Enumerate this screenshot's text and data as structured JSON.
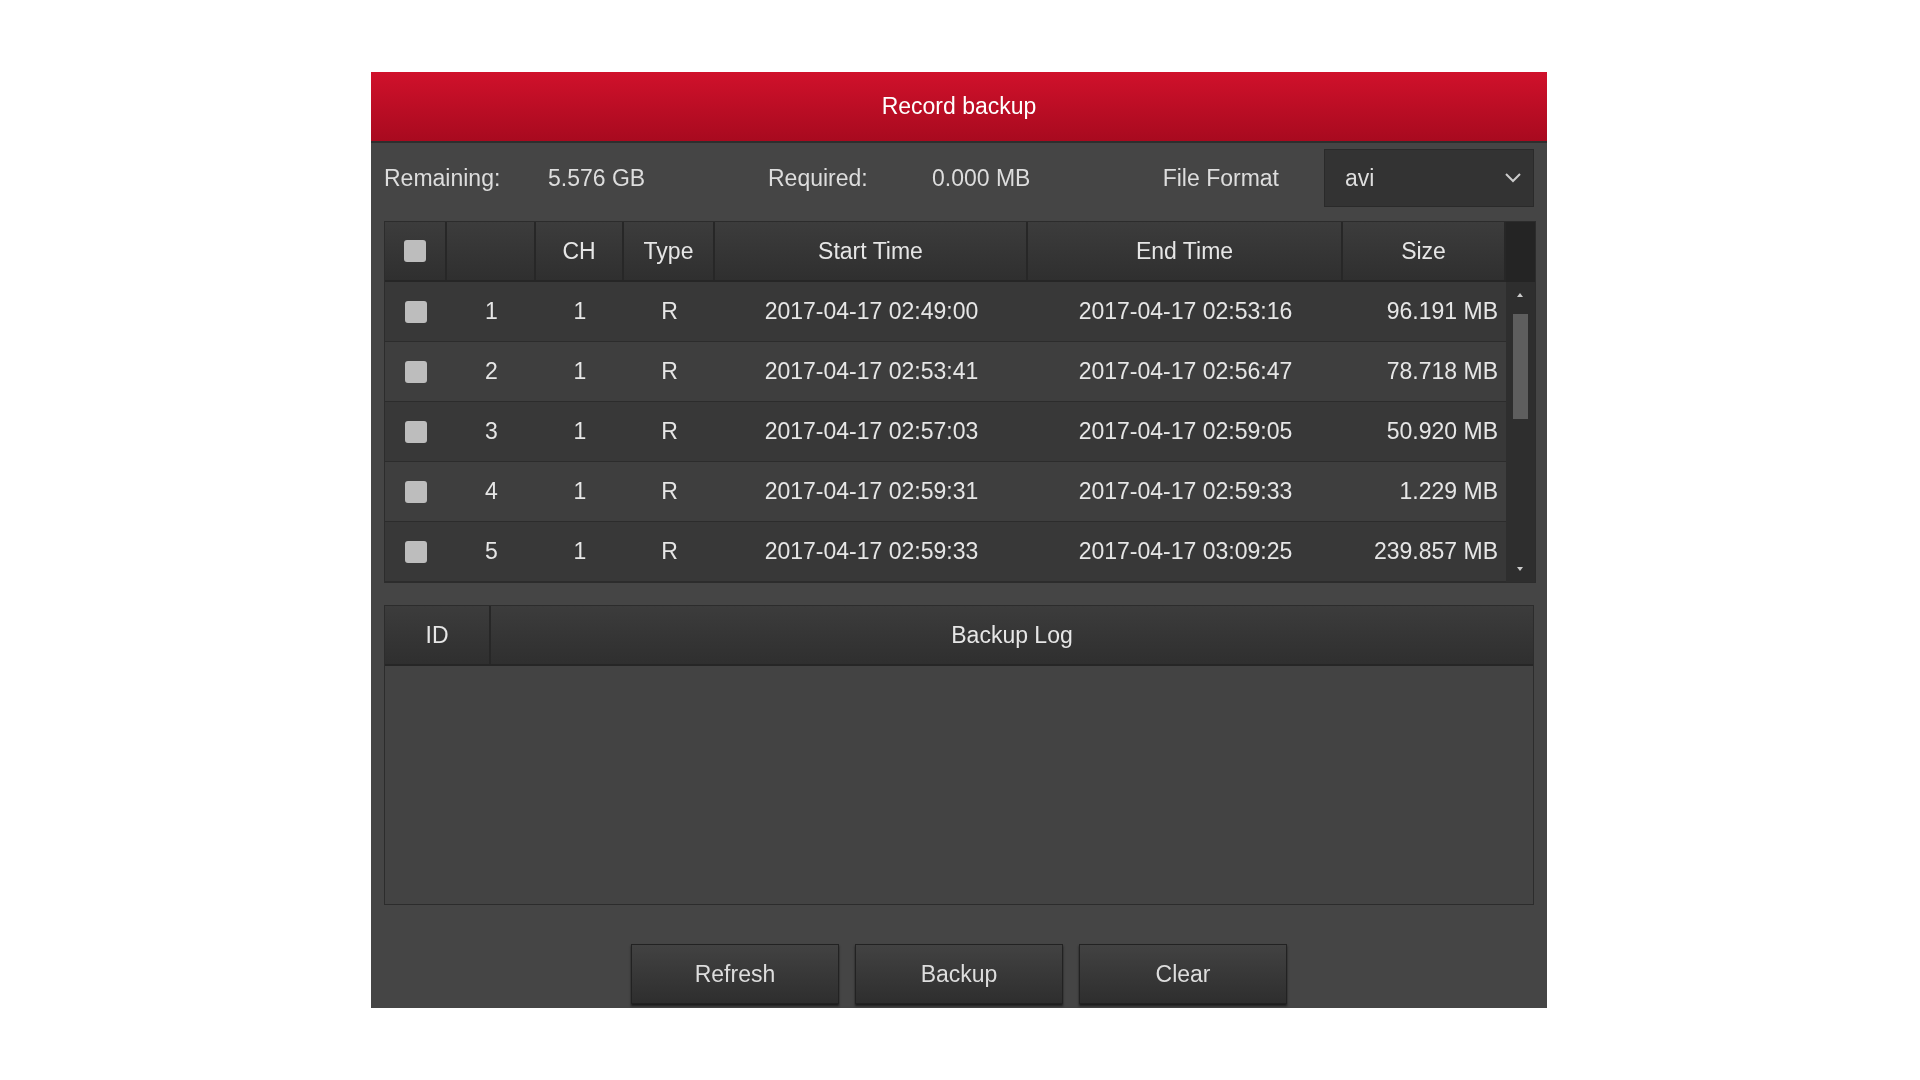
{
  "window": {
    "title": "Record backup"
  },
  "info": [
    {
      "label": "Remaining:",
      "value": "5.576 GB"
    },
    {
      "label": "Required:",
      "value": "0.000 MB"
    }
  ],
  "file_format": {
    "label": "File Format",
    "value": "avi"
  },
  "table": {
    "select_all": {
      "checked": false
    },
    "columns": [
      "",
      "CH",
      "Type",
      "Start Time",
      "End Time",
      "Size"
    ],
    "rows": [
      {
        "checked": false,
        "cells": [
          "1",
          "1",
          "R",
          "2017-04-17 02:49:00",
          "2017-04-17 02:53:16",
          "96.191 MB"
        ]
      },
      {
        "checked": false,
        "cells": [
          "2",
          "1",
          "R",
          "2017-04-17 02:53:41",
          "2017-04-17 02:56:47",
          "78.718 MB"
        ]
      },
      {
        "checked": false,
        "cells": [
          "3",
          "1",
          "R",
          "2017-04-17 02:57:03",
          "2017-04-17 02:59:05",
          "50.920 MB"
        ]
      },
      {
        "checked": false,
        "cells": [
          "4",
          "1",
          "R",
          "2017-04-17 02:59:31",
          "2017-04-17 02:59:33",
          "1.229 MB"
        ]
      },
      {
        "checked": false,
        "cells": [
          "5",
          "1",
          "R",
          "2017-04-17 02:59:33",
          "2017-04-17 03:09:25",
          "239.857 MB"
        ]
      }
    ]
  },
  "log_table": {
    "columns": [
      "ID",
      "Backup Log"
    ]
  },
  "buttons": [
    "Refresh",
    "Backup",
    "Clear"
  ]
}
